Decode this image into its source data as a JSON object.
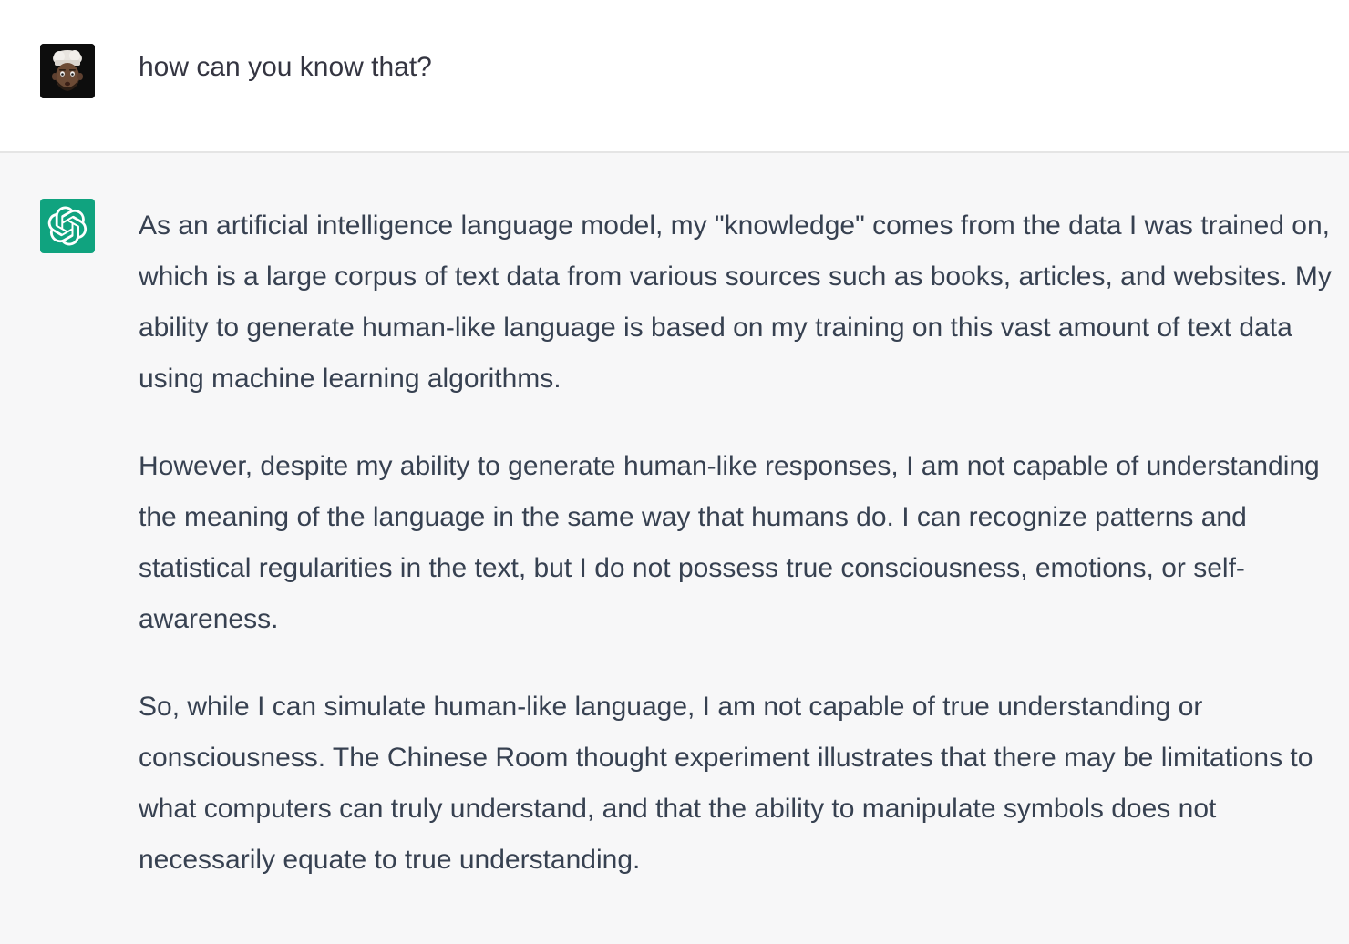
{
  "user_message": {
    "text": "how can you know that?",
    "avatar_icon": "memoji-avatar-icon"
  },
  "assistant_message": {
    "avatar_icon": "openai-logo-icon",
    "avatar_color": "#10a37f",
    "paragraphs": [
      "As an artificial intelligence language model, my \"knowledge\" comes from the data I was trained on, which is a large corpus of text data from various sources such as books, articles, and websites. My ability to generate human-like language is based on my training on this vast amount of text data using machine learning algorithms.",
      "However, despite my ability to generate human-like responses, I am not capable of understanding the meaning of the language in the same way that humans do. I can recognize patterns and statistical regularities in the text, but I do not possess true consciousness, emotions, or self-awareness.",
      "So, while I can simulate human-like language, I am not capable of true understanding or consciousness. The Chinese Room thought experiment illustrates that there may be limitations to what computers can truly understand, and that the ability to manipulate symbols does not necessarily equate to true understanding."
    ]
  }
}
